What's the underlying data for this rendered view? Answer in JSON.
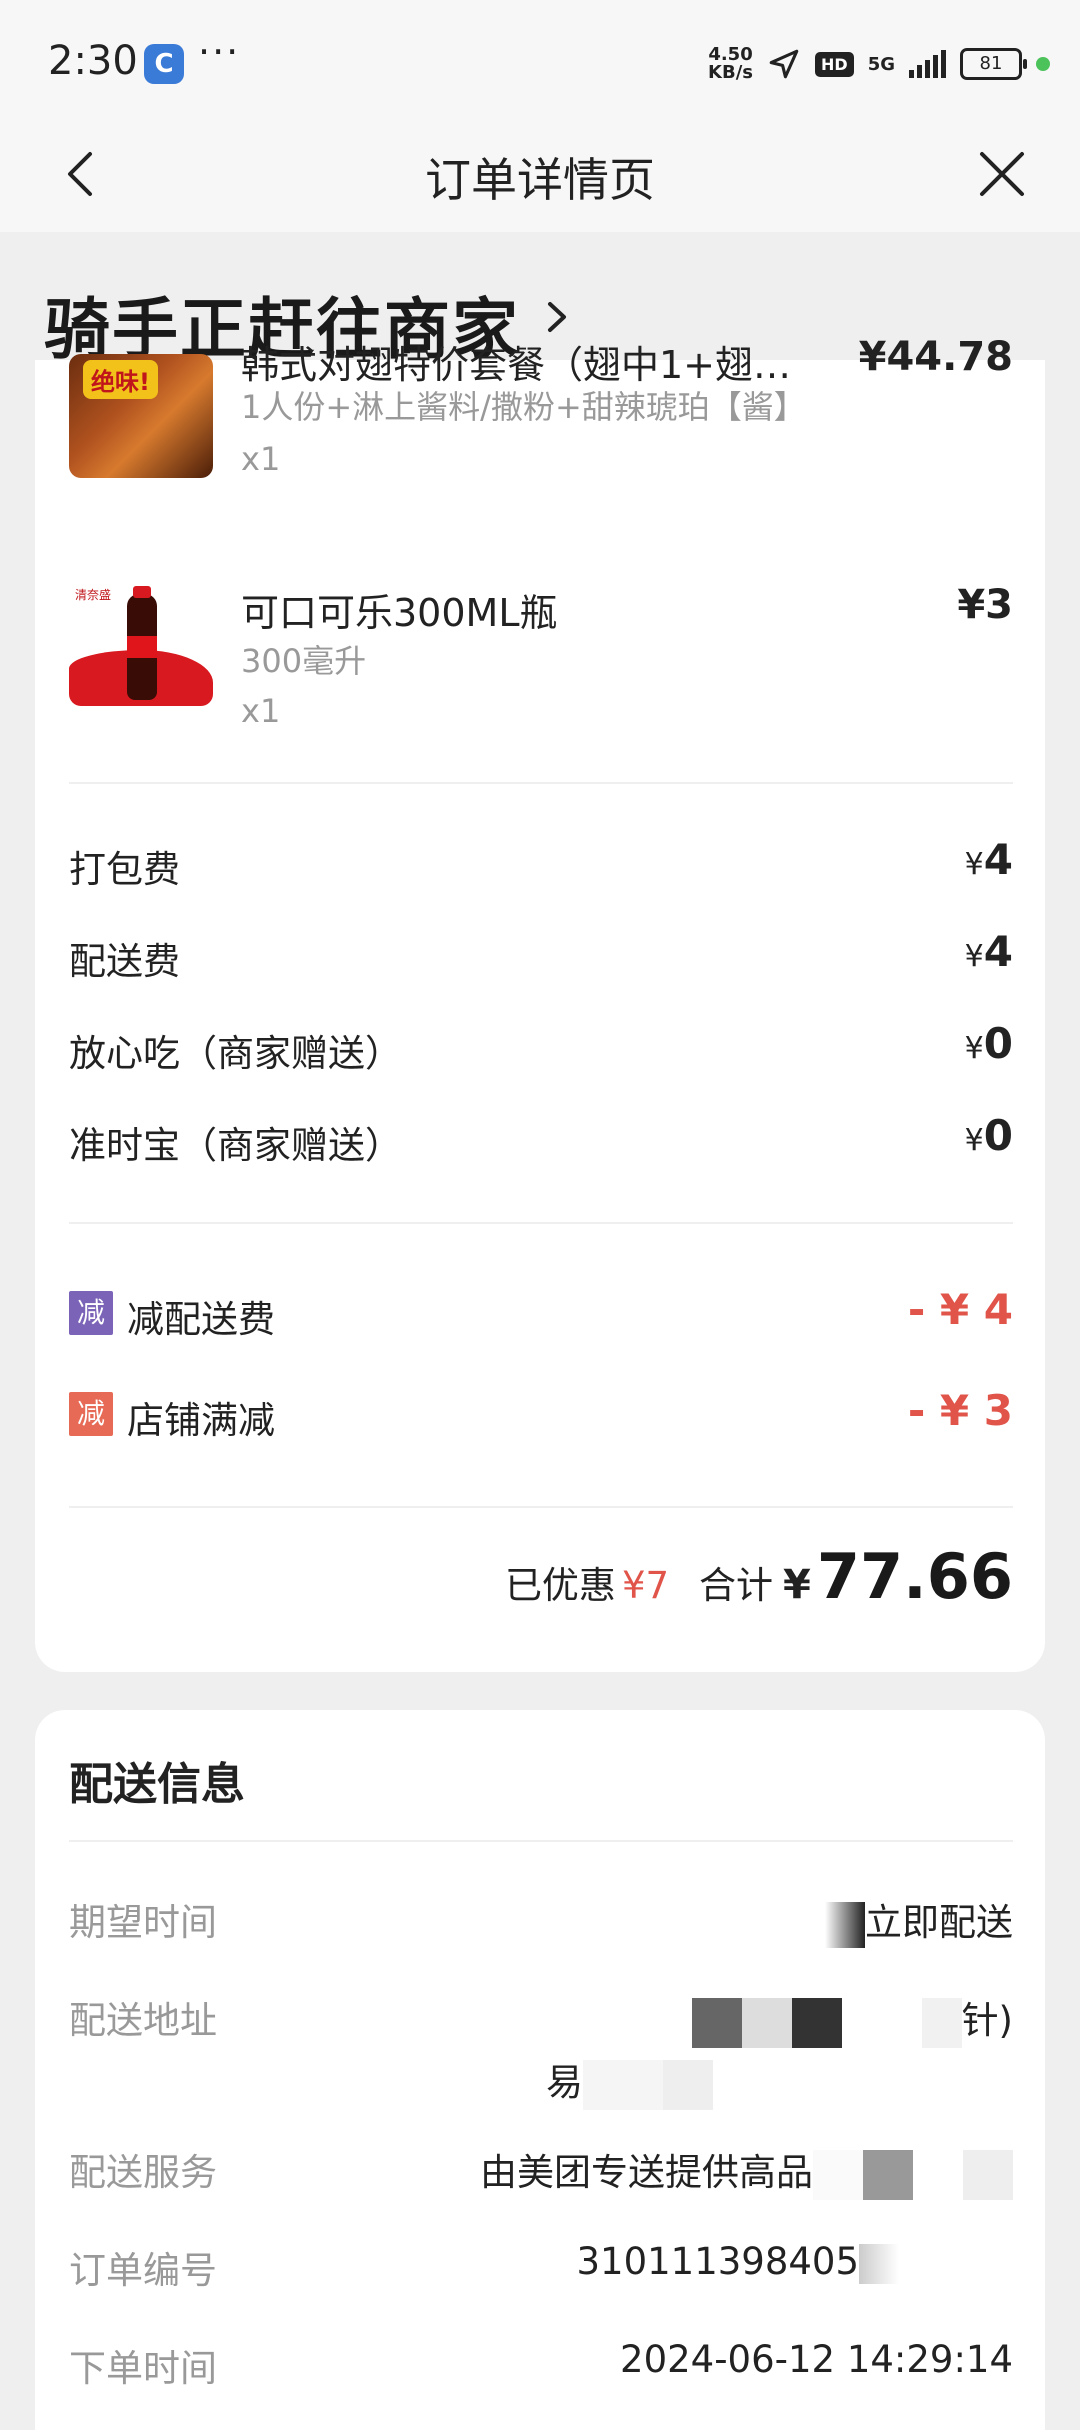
{
  "status_bar": {
    "time": "2:30",
    "app_icon_letter": "C",
    "more_dots": "···",
    "net_speed_value": "4.50",
    "net_speed_unit": "KB/s",
    "hd": "HD",
    "network": "5G",
    "battery": "81"
  },
  "nav": {
    "title": "订单详情页",
    "back_icon": "chevron-left-icon",
    "close_icon": "close-icon"
  },
  "order_status": {
    "text": "骑手正赶往商家",
    "arrow_icon": "chevron-right-icon"
  },
  "items": [
    {
      "name": "韩式对翅特价套餐（翅中1+翅…",
      "spec": "1人份+淋上酱料/撒粉+甜辣琥珀【酱】",
      "qty": "x1",
      "price": "¥44.78",
      "thumb_badge": "绝味!"
    },
    {
      "name": "可口可乐300ML瓶",
      "spec": "300毫升",
      "qty": "x1",
      "price": "¥3",
      "thumb_brand": "清奈盛"
    }
  ],
  "fees": [
    {
      "label": "打包费",
      "yen": "¥",
      "value": "4"
    },
    {
      "label": "配送费",
      "yen": "¥",
      "value": "4"
    },
    {
      "label": "放心吃（商家赠送）",
      "yen": "¥",
      "value": "0"
    },
    {
      "label": "准时宝（商家赠送）",
      "yen": "¥",
      "value": "0"
    }
  ],
  "discounts": [
    {
      "badge": "减",
      "label": "减配送费",
      "value": "- ¥ 4",
      "badge_color": "#7b63b8"
    },
    {
      "badge": "减",
      "label": "店铺满减",
      "value": "- ¥ 3",
      "badge_color": "#e66a55"
    }
  ],
  "summary": {
    "saved_label": "已优惠",
    "saved_value": "¥7",
    "total_label": "合计",
    "total_yen": "¥",
    "total_value": "77.66"
  },
  "delivery": {
    "title": "配送信息",
    "rows": [
      {
        "label": "期望时间",
        "value": "立即配送"
      },
      {
        "label": "配送地址",
        "value": "针)",
        "value2": "易"
      },
      {
        "label": "配送服务",
        "value": "由美团专送提供高品"
      },
      {
        "label": "订单编号",
        "value": "310111398405"
      },
      {
        "label": "下单时间",
        "value": "2024-06-12 14:29:14"
      }
    ]
  },
  "colors": {
    "discount_red": "#e0544a",
    "badge_purple": "#7b63b8",
    "badge_orange": "#e66a55"
  }
}
